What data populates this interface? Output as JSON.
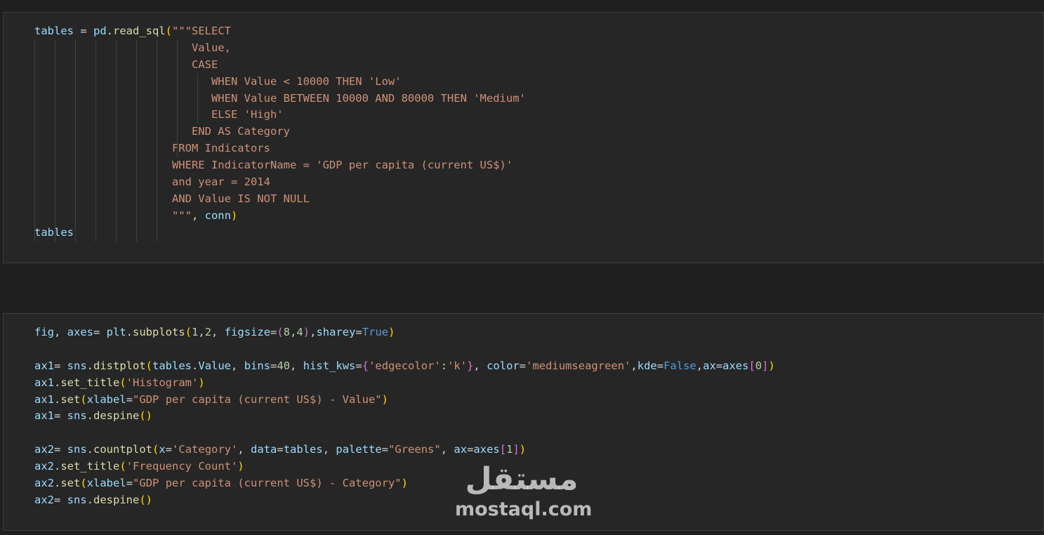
{
  "colors": {
    "background": "#1f1f1f",
    "cell_background": "#262626",
    "default": "#d4d4d4",
    "variable": "#9cdcfe",
    "string": "#ce9178",
    "function": "#dcdcaa",
    "number": "#b5cea8",
    "keyword_constant": "#569cd6",
    "bracket_gold": "#ffd700",
    "bracket_pink": "#da70d6",
    "bracket_blue": "#179fff"
  },
  "cells": [
    {
      "lines": [
        [
          [
            "tables",
            "variable"
          ],
          [
            " = ",
            "default"
          ],
          [
            "pd",
            "variable"
          ],
          [
            ".",
            "default"
          ],
          [
            "read_sql",
            "function"
          ],
          [
            "(",
            "bracket_gold"
          ],
          [
            "\"\"\"SELECT",
            "string"
          ]
        ],
        [
          [
            "                        Value,",
            "string"
          ]
        ],
        [
          [
            "                        CASE",
            "string"
          ]
        ],
        [
          [
            "                           WHEN Value < 10000 THEN 'Low'",
            "string"
          ]
        ],
        [
          [
            "                           WHEN Value BETWEEN 10000 AND 80000 THEN 'Medium'",
            "string"
          ]
        ],
        [
          [
            "                           ELSE 'High'",
            "string"
          ]
        ],
        [
          [
            "                        END AS Category",
            "string"
          ]
        ],
        [
          [
            "                     FROM Indicators",
            "string"
          ]
        ],
        [
          [
            "                     WHERE IndicatorName = 'GDP per capita (current US$)'",
            "string"
          ]
        ],
        [
          [
            "                     and year = 2014",
            "string"
          ]
        ],
        [
          [
            "                     AND Value IS NOT NULL",
            "string"
          ]
        ],
        [
          [
            "                     \"\"\"",
            "string"
          ],
          [
            ", ",
            "default"
          ],
          [
            "conn",
            "variable"
          ],
          [
            ")",
            "bracket_gold"
          ]
        ],
        [
          [
            "tables",
            "variable"
          ]
        ]
      ]
    },
    {
      "lines": [
        [
          [
            "fig",
            "variable"
          ],
          [
            ", ",
            "default"
          ],
          [
            "axes",
            "variable"
          ],
          [
            "= ",
            "default"
          ],
          [
            "plt",
            "variable"
          ],
          [
            ".",
            "default"
          ],
          [
            "subplots",
            "function"
          ],
          [
            "(",
            "bracket_gold"
          ],
          [
            "1",
            "number"
          ],
          [
            ",",
            "default"
          ],
          [
            "2",
            "number"
          ],
          [
            ", ",
            "default"
          ],
          [
            "figsize",
            "variable"
          ],
          [
            "=",
            "default"
          ],
          [
            "(",
            "bracket_pink"
          ],
          [
            "8",
            "number"
          ],
          [
            ",",
            "default"
          ],
          [
            "4",
            "number"
          ],
          [
            ")",
            "bracket_pink"
          ],
          [
            ",",
            "default"
          ],
          [
            "sharey",
            "variable"
          ],
          [
            "=",
            "default"
          ],
          [
            "True",
            "keyword_constant"
          ],
          [
            ")",
            "bracket_gold"
          ]
        ],
        [
          [
            "",
            "default"
          ]
        ],
        [
          [
            "ax1",
            "variable"
          ],
          [
            "= ",
            "default"
          ],
          [
            "sns",
            "variable"
          ],
          [
            ".",
            "default"
          ],
          [
            "distplot",
            "function"
          ],
          [
            "(",
            "bracket_gold"
          ],
          [
            "tables",
            "variable"
          ],
          [
            ".",
            "default"
          ],
          [
            "Value",
            "variable"
          ],
          [
            ", ",
            "default"
          ],
          [
            "bins",
            "variable"
          ],
          [
            "=",
            "default"
          ],
          [
            "40",
            "number"
          ],
          [
            ", ",
            "default"
          ],
          [
            "hist_kws",
            "variable"
          ],
          [
            "=",
            "default"
          ],
          [
            "{",
            "bracket_pink"
          ],
          [
            "'edgecolor'",
            "string"
          ],
          [
            ":",
            "default"
          ],
          [
            "'k'",
            "string"
          ],
          [
            "}",
            "bracket_pink"
          ],
          [
            ", ",
            "default"
          ],
          [
            "color",
            "variable"
          ],
          [
            "=",
            "default"
          ],
          [
            "'mediumseagreen'",
            "string"
          ],
          [
            ",",
            "default"
          ],
          [
            "kde",
            "variable"
          ],
          [
            "=",
            "default"
          ],
          [
            "False",
            "keyword_constant"
          ],
          [
            ",",
            "default"
          ],
          [
            "ax",
            "variable"
          ],
          [
            "=",
            "default"
          ],
          [
            "axes",
            "variable"
          ],
          [
            "[",
            "bracket_pink"
          ],
          [
            "0",
            "number"
          ],
          [
            "]",
            "bracket_pink"
          ],
          [
            ")",
            "bracket_gold"
          ]
        ],
        [
          [
            "ax1",
            "variable"
          ],
          [
            ".",
            "default"
          ],
          [
            "set_title",
            "function"
          ],
          [
            "(",
            "bracket_gold"
          ],
          [
            "'Histogram'",
            "string"
          ],
          [
            ")",
            "bracket_gold"
          ]
        ],
        [
          [
            "ax1",
            "variable"
          ],
          [
            ".",
            "default"
          ],
          [
            "set",
            "function"
          ],
          [
            "(",
            "bracket_gold"
          ],
          [
            "xlabel",
            "variable"
          ],
          [
            "=",
            "default"
          ],
          [
            "\"GDP per capita (current US$) - Value\"",
            "string"
          ],
          [
            ")",
            "bracket_gold"
          ]
        ],
        [
          [
            "ax1",
            "variable"
          ],
          [
            "= ",
            "default"
          ],
          [
            "sns",
            "variable"
          ],
          [
            ".",
            "default"
          ],
          [
            "despine",
            "function"
          ],
          [
            "()",
            "bracket_gold"
          ]
        ],
        [
          [
            "",
            "default"
          ]
        ],
        [
          [
            "ax2",
            "variable"
          ],
          [
            "= ",
            "default"
          ],
          [
            "sns",
            "variable"
          ],
          [
            ".",
            "default"
          ],
          [
            "countplot",
            "function"
          ],
          [
            "(",
            "bracket_gold"
          ],
          [
            "x",
            "variable"
          ],
          [
            "=",
            "default"
          ],
          [
            "'Category'",
            "string"
          ],
          [
            ", ",
            "default"
          ],
          [
            "data",
            "variable"
          ],
          [
            "=",
            "default"
          ],
          [
            "tables",
            "variable"
          ],
          [
            ", ",
            "default"
          ],
          [
            "palette",
            "variable"
          ],
          [
            "=",
            "default"
          ],
          [
            "\"Greens\"",
            "string"
          ],
          [
            ", ",
            "default"
          ],
          [
            "ax",
            "variable"
          ],
          [
            "=",
            "default"
          ],
          [
            "axes",
            "variable"
          ],
          [
            "[",
            "bracket_pink"
          ],
          [
            "1",
            "number"
          ],
          [
            "]",
            "bracket_pink"
          ],
          [
            ")",
            "bracket_gold"
          ]
        ],
        [
          [
            "ax2",
            "variable"
          ],
          [
            ".",
            "default"
          ],
          [
            "set_title",
            "function"
          ],
          [
            "(",
            "bracket_gold"
          ],
          [
            "'Frequency Count'",
            "string"
          ],
          [
            ")",
            "bracket_gold"
          ]
        ],
        [
          [
            "ax2",
            "variable"
          ],
          [
            ".",
            "default"
          ],
          [
            "set",
            "function"
          ],
          [
            "(",
            "bracket_gold"
          ],
          [
            "xlabel",
            "variable"
          ],
          [
            "=",
            "default"
          ],
          [
            "\"GDP per capita (current US$) - Category\"",
            "string"
          ],
          [
            ")",
            "bracket_gold"
          ]
        ],
        [
          [
            "ax2",
            "variable"
          ],
          [
            "= ",
            "default"
          ],
          [
            "sns",
            "variable"
          ],
          [
            ".",
            "default"
          ],
          [
            "despine",
            "function"
          ],
          [
            "()",
            "bracket_gold"
          ]
        ]
      ]
    }
  ],
  "watermark": {
    "arabic": "مستقل",
    "latin": "mostaql.com"
  }
}
